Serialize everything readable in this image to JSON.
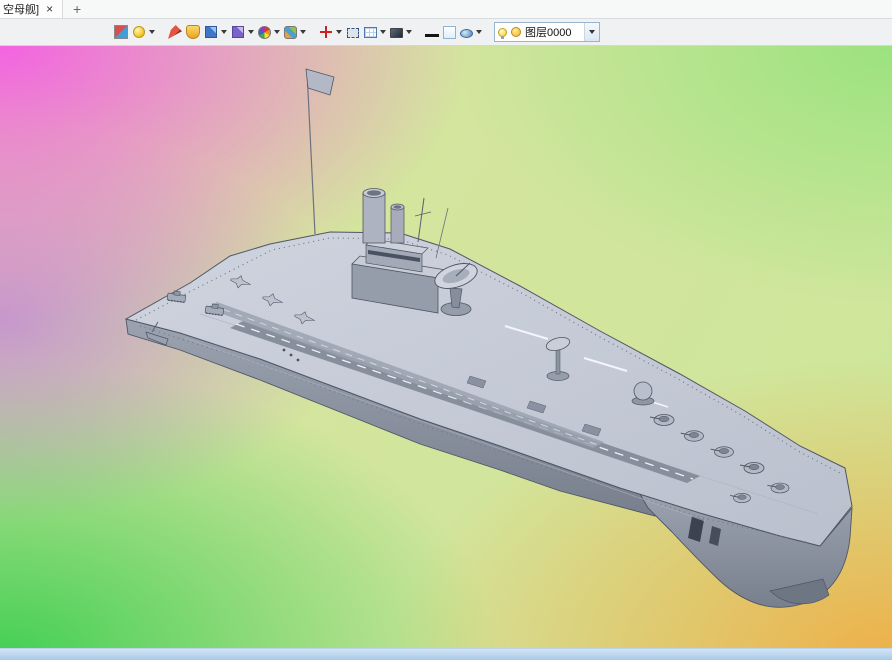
{
  "tabbar": {
    "tab_title": "空母舰]",
    "close_glyph": "×",
    "new_tab_glyph": "+"
  },
  "toolbar": {
    "layer_selector": {
      "value": "图层0000"
    },
    "icons": [
      "render-mode-icon",
      "light-icon",
      "sketch-icon",
      "material-icon",
      "solid-display-icon",
      "transparent-display-icon",
      "color-wheel-icon",
      "texture-icon",
      "coordinate-axis-icon",
      "window-select-icon",
      "grid-view-icon",
      "screen-display-icon",
      "line-width-icon",
      "background-color-icon",
      "lens-view-icon",
      "layer-visibility-icon",
      "layer-color-icon"
    ]
  },
  "viewport": {
    "model": "aircraft-carrier",
    "model_color": "#c3c9d4",
    "background_corners": {
      "top_left": "#f45ce4",
      "top_right": "#96e27d",
      "bottom_left": "#3ace50",
      "bottom_right": "#f2aa40"
    },
    "bottom_bar_color": "#b9d4ec"
  }
}
